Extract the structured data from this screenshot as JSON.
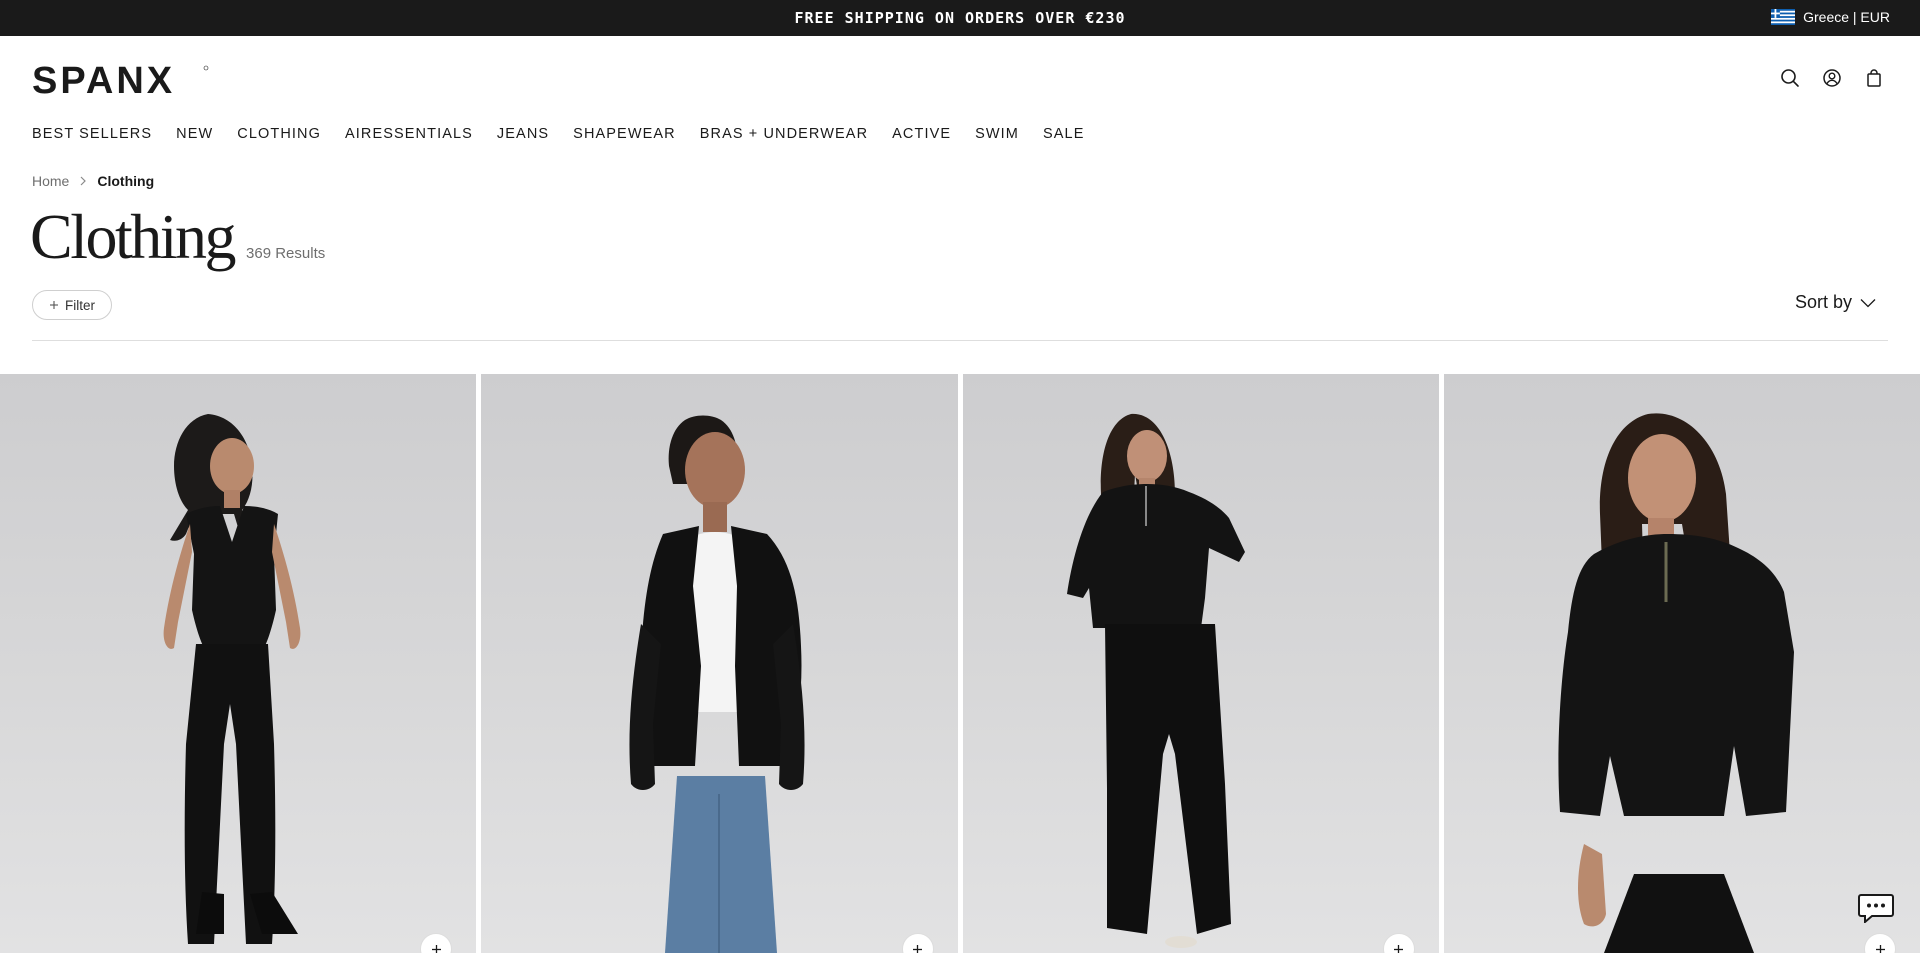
{
  "announcement": {
    "text": "FREE SHIPPING ON ORDERS OVER €230"
  },
  "locale": {
    "label": "Greece | EUR",
    "flag_icon": "greece-flag-icon"
  },
  "brand": {
    "name": "SPANX"
  },
  "header_icons": [
    "search-icon",
    "account-icon",
    "cart-icon"
  ],
  "nav": {
    "items": [
      {
        "label": "BEST SELLERS"
      },
      {
        "label": "NEW"
      },
      {
        "label": "CLOTHING"
      },
      {
        "label": "AIRESSENTIALS"
      },
      {
        "label": "JEANS"
      },
      {
        "label": "SHAPEWEAR"
      },
      {
        "label": "BRAS + UNDERWEAR"
      },
      {
        "label": "ACTIVE"
      },
      {
        "label": "SWIM"
      },
      {
        "label": "SALE"
      }
    ]
  },
  "breadcrumb": {
    "home": "Home",
    "current": "Clothing"
  },
  "page": {
    "title": "Clothing",
    "results": "369 Results"
  },
  "toolbar": {
    "filter_label": "Filter",
    "sort_label": "Sort by"
  },
  "products": [
    {
      "image": "model-black-vneck-tank-and-flare-pants",
      "quick_add_icon": "plus-icon"
    },
    {
      "image": "model-black-blazer-white-tee-jeans",
      "quick_add_icon": "plus-icon"
    },
    {
      "image": "model-black-half-zip-wide-leg-pants",
      "quick_add_icon": "plus-icon"
    },
    {
      "image": "model-black-half-zip-pullover-closeup",
      "quick_add_icon": "plus-icon"
    }
  ],
  "colors": {
    "announcement_bg": "#1a1a1a",
    "text": "#1a1a1a",
    "muted": "#6e6e6e",
    "product_bg": "#d5d5d6"
  }
}
